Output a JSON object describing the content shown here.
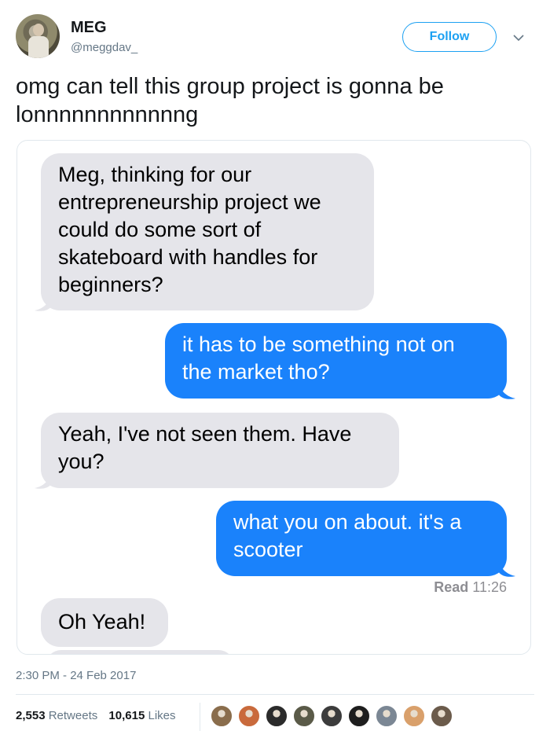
{
  "author": {
    "name": "MEG",
    "handle": "@meggdav_",
    "avatar_icon": "user-avatar"
  },
  "follow_label": "Follow",
  "tweet_text": "omg can tell this group project is gonna be lonnnnnnnnnnnng",
  "conversation": {
    "messages": [
      {
        "side": "received",
        "text": "Meg, thinking for our entrepreneurship project we could do some sort of skateboard with handles for beginners?"
      },
      {
        "side": "sent",
        "text": "it has to be something not on the market tho?"
      },
      {
        "side": "received",
        "text": "Yeah, I've not seen them. Have you?"
      },
      {
        "side": "sent",
        "text": "what you on about. it's a scooter"
      },
      {
        "side": "received",
        "text": "Oh Yeah!"
      }
    ],
    "read_receipt": {
      "label": "Read",
      "time": "11:26"
    }
  },
  "timestamp": "2:30 PM - 24 Feb 2017",
  "stats": {
    "retweets_count": "2,553",
    "retweets_label": "Retweets",
    "likes_count": "10,615",
    "likes_label": "Likes"
  },
  "likers": [
    {
      "icon": "liker-avatar",
      "color": "#8a6d4c"
    },
    {
      "icon": "liker-avatar",
      "color": "#c96a3c"
    },
    {
      "icon": "liker-avatar",
      "color": "#2b2b2b"
    },
    {
      "icon": "liker-avatar",
      "color": "#5a5a48"
    },
    {
      "icon": "liker-avatar",
      "color": "#3c3c3c"
    },
    {
      "icon": "liker-avatar",
      "color": "#1e1e1e"
    },
    {
      "icon": "liker-avatar",
      "color": "#7b8794"
    },
    {
      "icon": "liker-avatar",
      "color": "#d9a06b"
    },
    {
      "icon": "liker-avatar",
      "color": "#6b5b4b"
    }
  ],
  "colors": {
    "twitter_blue": "#1da1f2",
    "imessage_blue": "#1a82fb",
    "received_gray": "#e5e5ea"
  }
}
